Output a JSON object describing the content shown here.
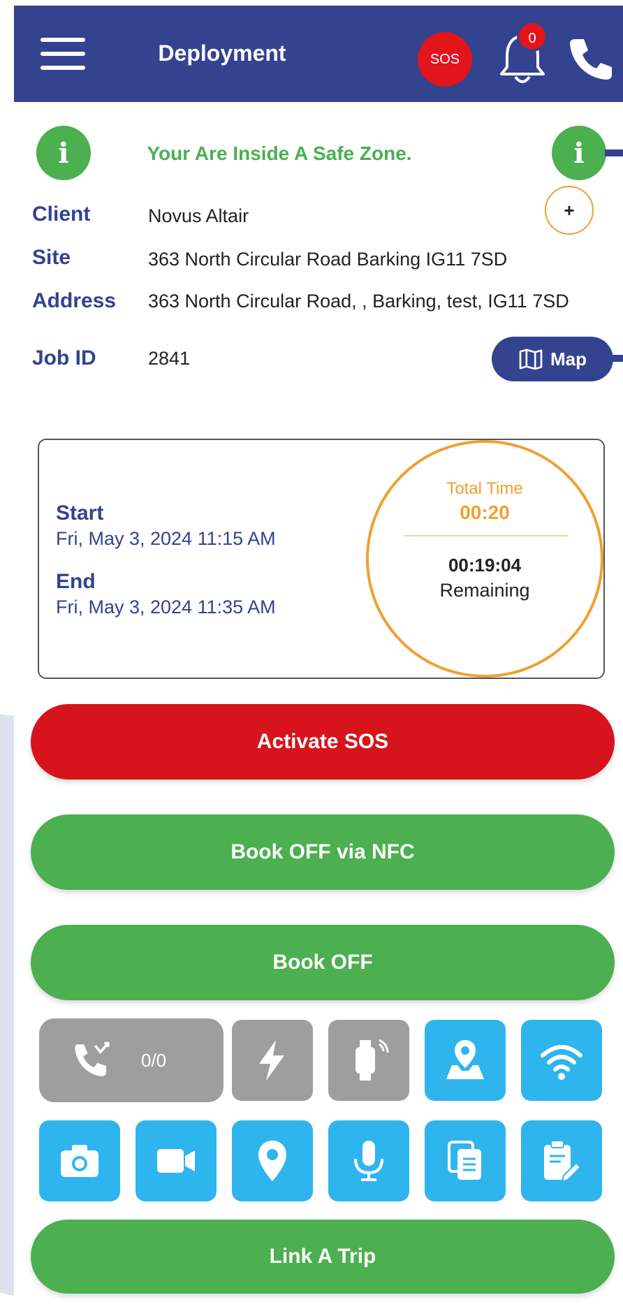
{
  "header": {
    "title": "Deployment",
    "sos_label": "SOS",
    "notification_count": "0"
  },
  "zone": {
    "message": "Your Are Inside A Safe Zone."
  },
  "details": {
    "client_label": "Client",
    "client_value": "Novus Altair",
    "site_label": "Site",
    "site_value": "363 North Circular Road Barking IG11 7SD",
    "address_label": "Address",
    "address_value": "363 North Circular Road, , Barking, test, IG11 7SD",
    "job_label": "Job ID",
    "job_value": "2841",
    "map_label": "Map"
  },
  "timer": {
    "start_label": "Start",
    "start_value": "Fri, May 3, 2024 11:15 AM",
    "end_label": "End",
    "end_value": "Fri, May 3, 2024 11:35 AM",
    "total_label": "Total Time",
    "total_value": "00:20",
    "remaining_value": "00:19:04",
    "remaining_label": "Remaining",
    "add_label": "+"
  },
  "actions": {
    "sos": "Activate SOS",
    "nfc": "Book OFF via NFC",
    "book_off": "Book OFF",
    "link_trip": "Link A Trip"
  },
  "calls": {
    "count": "0/0"
  },
  "colors": {
    "header": "#33438f",
    "sos_red": "#d7141c",
    "green": "#4caf50",
    "tile_blue": "#2fb5ee",
    "tile_grey": "#9e9e9e",
    "ring_orange": "#f0a030"
  }
}
